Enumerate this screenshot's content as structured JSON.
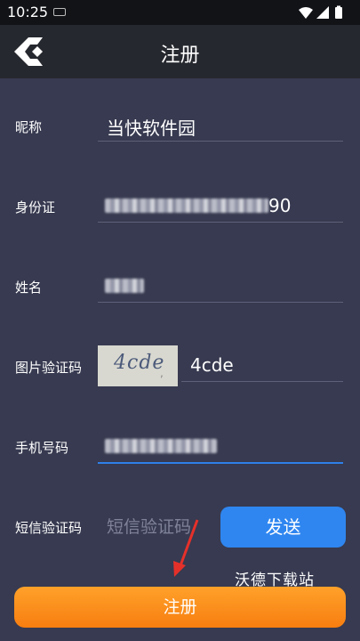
{
  "status": {
    "time": "10:25"
  },
  "header": {
    "title": "注册"
  },
  "form": {
    "nickname_label": "昵称",
    "nickname_value": "当快软件园",
    "id_label": "身份证",
    "id_visible_suffix": "90",
    "name_label": "姓名",
    "captcha_label": "图片验证码",
    "captcha_image_text": "4cde",
    "captcha_value": "4cde",
    "phone_label": "手机号码",
    "sms_label": "短信验证码",
    "sms_placeholder": "短信验证码",
    "send_button": "发送"
  },
  "watermark": "沃德下载站",
  "register_button": "注册",
  "colors": {
    "accent_blue": "#2f86f0",
    "primary_orange": "#f88a1c",
    "background": "#373a50"
  }
}
